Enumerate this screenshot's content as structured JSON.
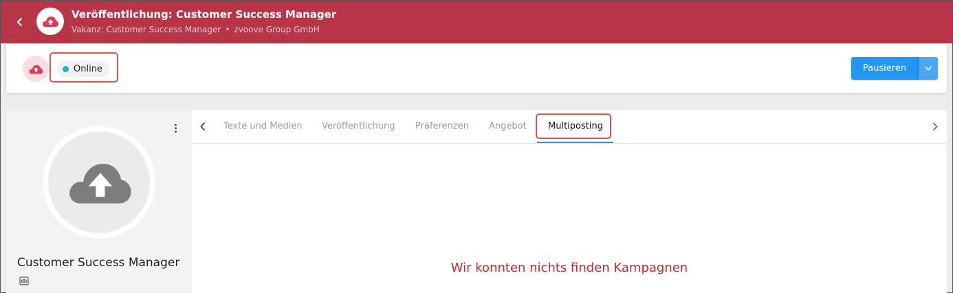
{
  "header": {
    "title": "Veröffentlichung: Customer Success Manager",
    "subtitle_part1": "Vakanz: Customer Success Manager",
    "subtitle_separator": "•",
    "subtitle_part2": "zvoove Group GmbH"
  },
  "status": {
    "label": "Online",
    "dot_color": "#13b6c8"
  },
  "actions": {
    "pause_label": "Pausieren"
  },
  "profile": {
    "title": "Customer Success Manager"
  },
  "tabs": [
    {
      "label": "Texte und Medien"
    },
    {
      "label": "Veröffentlichung"
    },
    {
      "label": "Präferenzen"
    },
    {
      "label": "Angebot"
    },
    {
      "label": "Multiposting",
      "active": true
    }
  ],
  "content": {
    "empty_message": "Wir konnten nichts finden Kampagnen"
  },
  "colors": {
    "header_bg": "#b83548",
    "primary": "#2196f3",
    "highlight": "#d9534f",
    "error_text": "#c62828"
  },
  "icons": {
    "back": "chevron-left-icon",
    "upload": "cloud-upload-icon",
    "more": "more-vertical-icon",
    "dropdown": "chevron-down-icon",
    "eye": "eye-icon"
  }
}
